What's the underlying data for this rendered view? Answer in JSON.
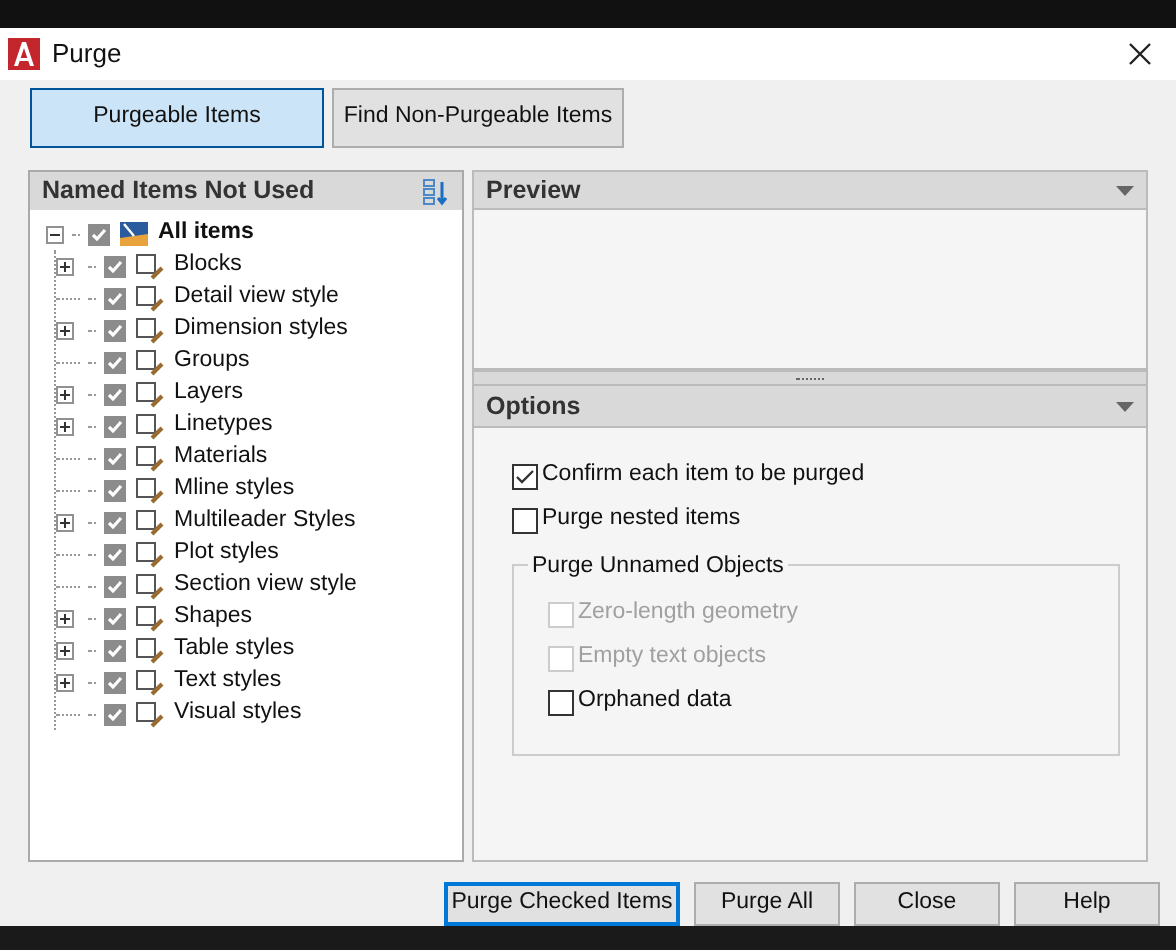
{
  "window": {
    "title": "Purge"
  },
  "tabs": [
    {
      "label": "Purgeable Items",
      "selected": true
    },
    {
      "label": "Find Non-Purgeable Items",
      "selected": false
    }
  ],
  "tree": {
    "title": "Named Items Not Used",
    "items": [
      {
        "label": "All items",
        "checked": true,
        "expanded": true,
        "children": [
          {
            "label": "Blocks",
            "checked": true,
            "expandable": true
          },
          {
            "label": "Detail view style",
            "checked": true,
            "expandable": false
          },
          {
            "label": "Dimension styles",
            "checked": true,
            "expandable": true
          },
          {
            "label": "Groups",
            "checked": true,
            "expandable": false
          },
          {
            "label": "Layers",
            "checked": true,
            "expandable": true
          },
          {
            "label": "Linetypes",
            "checked": true,
            "expandable": true
          },
          {
            "label": "Materials",
            "checked": true,
            "expandable": false
          },
          {
            "label": "Mline styles",
            "checked": true,
            "expandable": false
          },
          {
            "label": "Multileader Styles",
            "checked": true,
            "expandable": true
          },
          {
            "label": "Plot styles",
            "checked": true,
            "expandable": false
          },
          {
            "label": "Section view style",
            "checked": true,
            "expandable": false
          },
          {
            "label": "Shapes",
            "checked": true,
            "expandable": true
          },
          {
            "label": "Table styles",
            "checked": true,
            "expandable": true
          },
          {
            "label": "Text styles",
            "checked": true,
            "expandable": true
          },
          {
            "label": "Visual styles",
            "checked": true,
            "expandable": false
          }
        ]
      }
    ]
  },
  "preview": {
    "title": "Preview"
  },
  "options": {
    "title": "Options",
    "checkboxes": [
      {
        "label": "Confirm each item to be purged",
        "checked": true,
        "disabled": false
      },
      {
        "label": "Purge nested items",
        "checked": false,
        "disabled": false
      }
    ],
    "group": {
      "title": "Purge Unnamed Objects",
      "checkboxes": [
        {
          "label": "Zero-length geometry",
          "checked": false,
          "disabled": true
        },
        {
          "label": "Empty text objects",
          "checked": false,
          "disabled": true
        },
        {
          "label": "Orphaned data",
          "checked": false,
          "disabled": false
        }
      ]
    }
  },
  "buttons": [
    {
      "label": "Purge Checked Items",
      "default": true
    },
    {
      "label": "Purge All",
      "default": false
    },
    {
      "label": "Close",
      "default": false
    },
    {
      "label": "Help",
      "default": false
    }
  ]
}
